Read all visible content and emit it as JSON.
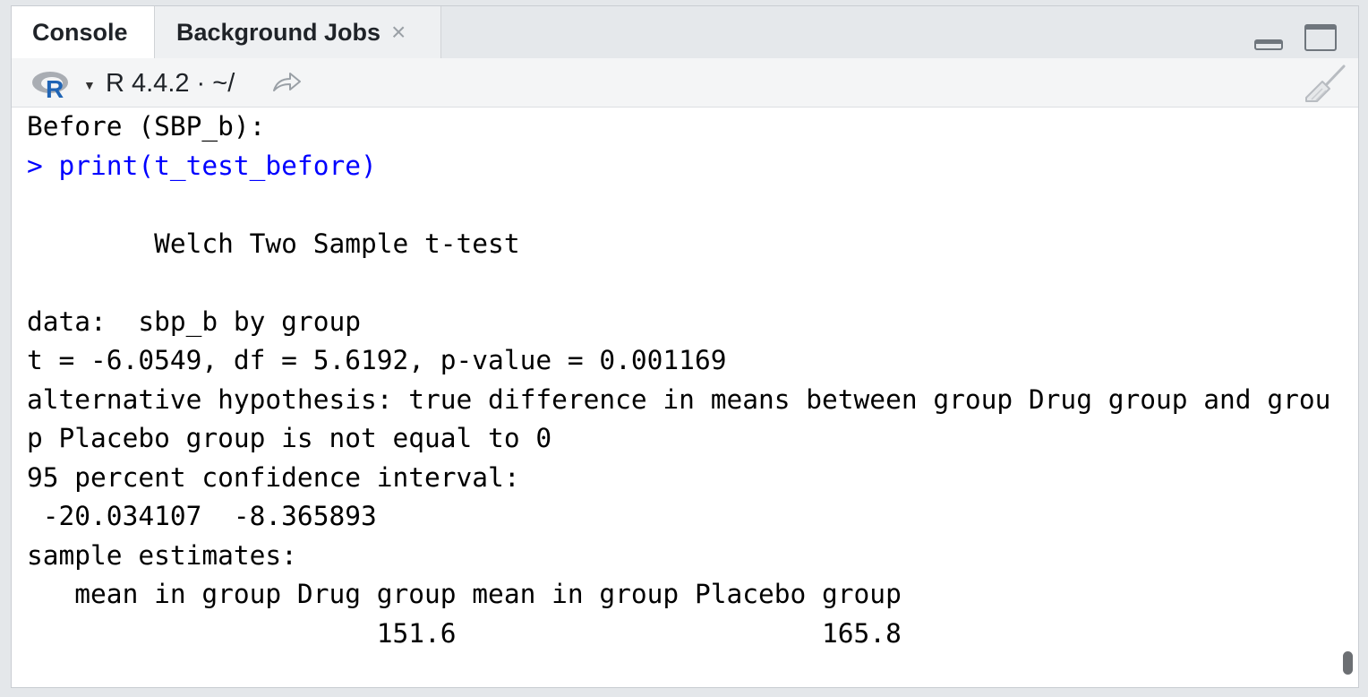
{
  "tabs": [
    {
      "label": "Console",
      "active": true
    },
    {
      "label": "Background Jobs",
      "close": "×"
    }
  ],
  "toolbar": {
    "r_logo": "R",
    "version": "R 4.4.2 · ~/",
    "icons": [
      "r-logo-icon",
      "chevron-down-icon",
      "share-arrow-icon",
      "broom-icon",
      "minimize-icon",
      "maximize-icon"
    ]
  },
  "console": {
    "lines": [
      {
        "text": "Before (SBP_b):",
        "type": "output"
      },
      {
        "text": "> print(t_test_before)",
        "type": "command"
      },
      {
        "text": "",
        "type": "output"
      },
      {
        "text": "        Welch Two Sample t-test",
        "type": "output"
      },
      {
        "text": "",
        "type": "output"
      },
      {
        "text": "data:  sbp_b by group",
        "type": "output"
      },
      {
        "text": "t = -6.0549, df = 5.6192, p-value = 0.001169",
        "type": "output"
      },
      {
        "text": "alternative hypothesis: true difference in means between group Drug group and grou",
        "type": "output"
      },
      {
        "text": "p Placebo group is not equal to 0",
        "type": "output"
      },
      {
        "text": "95 percent confidence interval:",
        "type": "output"
      },
      {
        "text": " -20.034107  -8.365893",
        "type": "output"
      },
      {
        "text": "sample estimates:",
        "type": "output"
      },
      {
        "text": "   mean in group Drug group mean in group Placebo group",
        "type": "output"
      },
      {
        "text": "                      151.6                       165.8",
        "type": "output"
      }
    ]
  },
  "colors": {
    "command": "#0000ff",
    "output": "#000000",
    "tabbar_bg": "#e5e8eb",
    "toolbar_bg": "#f4f5f6"
  }
}
